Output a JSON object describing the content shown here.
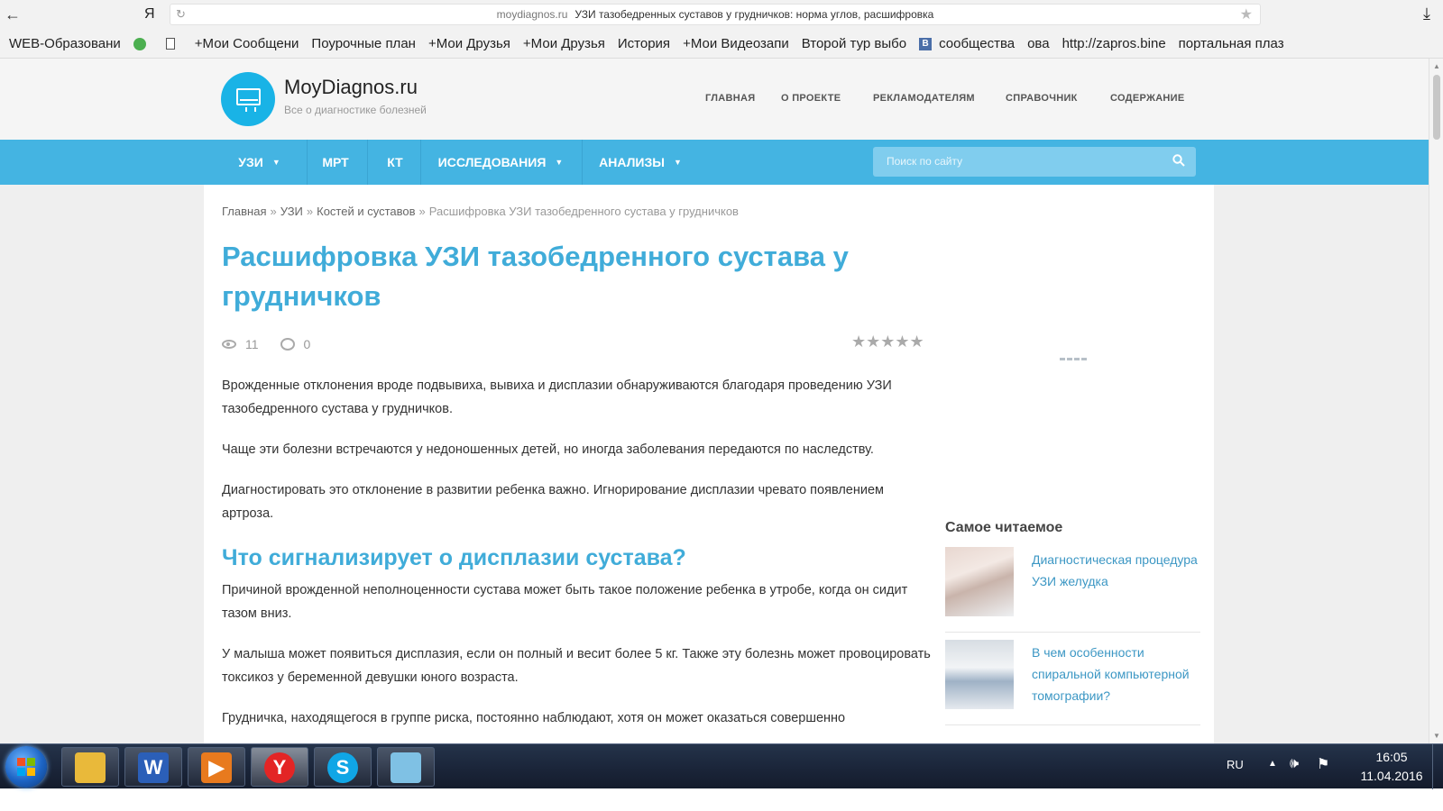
{
  "browser": {
    "back_glyph": "←",
    "yandex_glyph": "Я",
    "reload_glyph": "↻",
    "url_host": "moydiagnos.ru",
    "tab_title": "УЗИ тазобедренных суставов у грудничков: норма углов, расшифровка",
    "star_glyph": "★",
    "download_glyph": "⤓",
    "bookmarks": [
      {
        "label": "WEB-Образовани",
        "icon": "none"
      },
      {
        "label": "",
        "icon": "green-refresh-icon"
      },
      {
        "label": "",
        "icon": "document-icon"
      },
      {
        "label": "+Мои Сообщени",
        "icon": "none"
      },
      {
        "label": "Поурочные план",
        "icon": "none"
      },
      {
        "label": "+Мои Друзья",
        "icon": "none"
      },
      {
        "label": "+Мои Друзья",
        "icon": "none"
      },
      {
        "label": "История",
        "icon": "none"
      },
      {
        "label": "+Мои Видеозапи",
        "icon": "none"
      },
      {
        "label": "Второй тур выбо",
        "icon": "none"
      },
      {
        "label": "сообщества",
        "icon": "vk-icon"
      },
      {
        "label": "ова",
        "icon": "none"
      },
      {
        "label": "http://zapros.bine",
        "icon": "none"
      },
      {
        "label": "портальная плаз",
        "icon": "none"
      }
    ]
  },
  "site": {
    "name": "MoyDiagnos.ru",
    "tagline": "Все о диагностике болезней",
    "brand_color": "#44b4e2",
    "top_nav": [
      "ГЛАВНАЯ",
      "О ПРОЕКТЕ",
      "РЕКЛАМОДАТЕЛЯМ",
      "СПРАВОЧНИК",
      "СОДЕРЖАНИЕ"
    ],
    "main_nav": [
      {
        "label": "УЗИ",
        "dropdown": true
      },
      {
        "label": "МРТ",
        "dropdown": false
      },
      {
        "label": "КТ",
        "dropdown": false
      },
      {
        "label": "ИССЛЕДОВАНИЯ",
        "dropdown": true
      },
      {
        "label": "АНАЛИЗЫ",
        "dropdown": true
      }
    ],
    "search_placeholder": "Поиск по сайту"
  },
  "article": {
    "breadcrumbs": [
      "Главная",
      "УЗИ",
      "Костей и суставов"
    ],
    "breadcrumb_current": "Расшифровка УЗИ тазобедренного сустава у грудничков",
    "breadcrumb_sep": "»",
    "title": "Расшифровка УЗИ тазобедренного сустава у грудничков",
    "views": "11",
    "comments": "0",
    "rating_stars": "★★★★★",
    "paragraphs_1": [
      "Врожденные отклонения вроде подвывиха, вывиха и дисплазии обнаруживаются благодаря проведению УЗИ тазобедренного сустава у грудничков.",
      "Чаще эти болезни встречаются у недоношенных детей, но иногда заболевания передаются по наследству.",
      "Диагностировать это отклонение в развитии ребенка важно. Игнорирование дисплазии чревато появлением артроза."
    ],
    "subheading": "Что сигнализирует о дисплазии сустава?",
    "paragraphs_2": [
      "Причиной врожденной неполноценности сустава может быть такое положение ребенка в утробе, когда он сидит тазом вниз.",
      "У малыша может появиться дисплазия, если он полный и весит более 5 кг. Также эту болезнь может провоцировать токсикоз у беременной девушки юного возраста.",
      "Грудничка, находящегося в группе риска, постоянно наблюдают, хотя он может оказаться совершенно"
    ]
  },
  "sidebar": {
    "title": "Самое читаемое",
    "items": [
      {
        "label": "Диагностическая процедура УЗИ желудка"
      },
      {
        "label": "В чем особенности спиральной компьютерной томографии?"
      }
    ]
  },
  "taskbar": {
    "apps": [
      {
        "name": "explorer",
        "glyph": "",
        "color": "#e9b93a"
      },
      {
        "name": "word",
        "glyph": "W",
        "color": "#2b5fb8"
      },
      {
        "name": "media-player",
        "glyph": "▶",
        "color": "#e87a1e"
      },
      {
        "name": "yandex-browser",
        "glyph": "Y",
        "color": "#e32525"
      },
      {
        "name": "skype",
        "glyph": "S",
        "color": "#10a6e6"
      },
      {
        "name": "notepad",
        "glyph": "",
        "color": "#7fc1e4"
      }
    ],
    "active_app_index": 3,
    "language": "RU",
    "time": "16:05",
    "date": "11.04.2016"
  }
}
